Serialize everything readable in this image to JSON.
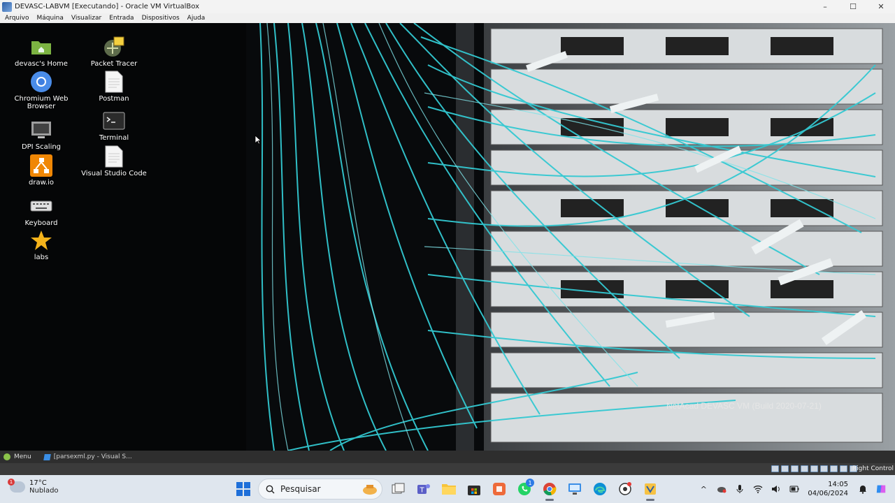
{
  "window": {
    "title": "DEVASC-LABVM [Executando] - Oracle VM VirtualBox",
    "controls": {
      "minimize": "–",
      "maximize": "☐",
      "close": "✕"
    }
  },
  "menubar": [
    "Arquivo",
    "Máquina",
    "Visualizar",
    "Entrada",
    "Dispositivos",
    "Ajuda"
  ],
  "desktop": {
    "icons": [
      {
        "label": "devasc's Home",
        "icon": "home-folder-icon"
      },
      {
        "label": "Chromium Web Browser",
        "icon": "chromium-icon"
      },
      {
        "label": "DPI Scaling",
        "icon": "monitor-icon"
      },
      {
        "label": "draw.io",
        "icon": "drawio-icon"
      },
      {
        "label": "Keyboard",
        "icon": "keyboard-icon"
      },
      {
        "label": "labs",
        "icon": "star-icon"
      },
      {
        "label": "Packet Tracer",
        "icon": "packet-tracer-icon"
      },
      {
        "label": "Postman",
        "icon": "document-icon"
      },
      {
        "label": "Terminal",
        "icon": "terminal-icon"
      },
      {
        "label": "Visual Studio Code",
        "icon": "document-icon"
      }
    ],
    "wallpaper_caption": "NetAcad DEVASC VM (Build 2020-07-21)"
  },
  "guest_panel": {
    "menu_label": "Menu",
    "task_label": "[parsexml.py - Visual S..."
  },
  "vb_status": {
    "host_key": "Right Control"
  },
  "taskbar": {
    "weather": {
      "temp": "17°C",
      "desc": "Nublado",
      "badge": "1"
    },
    "search_placeholder": "Pesquisar",
    "whatsapp_badge": "1",
    "clock": {
      "time": "14:05",
      "date": "04/06/2024"
    }
  },
  "colors": {
    "fiber": "#2fc6cf",
    "accent": "#2d7be5",
    "taskbar": "#dfe6ee"
  }
}
